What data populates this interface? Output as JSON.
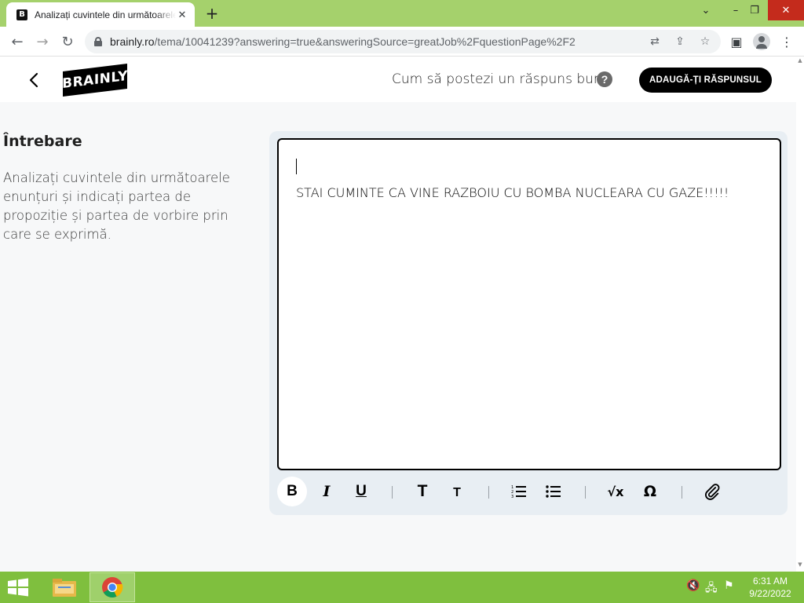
{
  "browser": {
    "tab_title": "Analizați cuvintele din următoarele",
    "tab_favicon": "B",
    "new_tab": "+",
    "url_host": "brainly.ro",
    "url_rest": "/tema/10041239?answering=true&answeringSource=greatJob%2FquestionPage%2F2",
    "icons": [
      "back-icon",
      "forward-icon",
      "reload-icon",
      "lock-icon",
      "translate-icon",
      "share-icon",
      "bookmark-star-icon",
      "side-panel-icon",
      "profile-icon",
      "menu-kebab-icon"
    ]
  },
  "header": {
    "logo": "BRAINLY",
    "howto": "Cum să postezi un răspuns bun",
    "help": "?",
    "add_answer": "ADAUGĂ-ȚI RĂSPUNSUL"
  },
  "question": {
    "heading": "Întrebare",
    "text": "Analizați cuvintele din următoarele enunțuri și indicați partea de propoziție și partea de vorbire prin care se exprimă."
  },
  "editor": {
    "answer_text": "STAI CUMINTE CA VINE RAZBOIU CU BOMBA NUCLEARA CU GAZE!!!!!"
  },
  "toolbar": {
    "bold": "B",
    "italic": "I",
    "underline": "U",
    "heading_large": "T",
    "heading_small": "T",
    "math": "√x",
    "omega": "Ω"
  },
  "taskbar": {
    "time": "6:31 AM",
    "date": "9/22/2022"
  }
}
